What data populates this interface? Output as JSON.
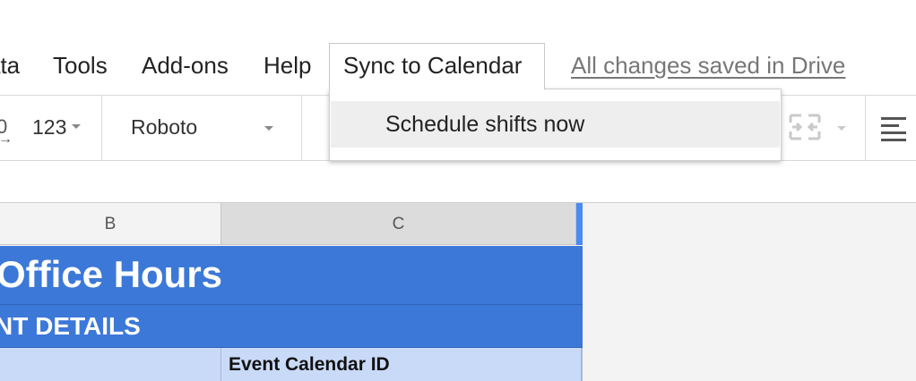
{
  "menubar": {
    "items": [
      {
        "label": "ata"
      },
      {
        "label": "Tools"
      },
      {
        "label": "Add-ons"
      },
      {
        "label": "Help"
      },
      {
        "label": "Sync to Calendar"
      }
    ],
    "save_status": "All changes saved in Drive"
  },
  "dropdown": {
    "items": [
      {
        "label": "Schedule shifts now"
      }
    ]
  },
  "toolbar": {
    "decimal_label": "0",
    "decimal_arrow": "→",
    "number_format_label": "123",
    "font_label": "Roboto",
    "merge_icon": "merge-cells-icon",
    "align_icon": "align-left-icon"
  },
  "sheet": {
    "column_headers": [
      "B",
      "C"
    ],
    "title": "Office Hours",
    "section": "NT DETAILS",
    "field_label": "Event Calendar ID"
  },
  "colors": {
    "header_blue": "#3c78d8",
    "light_blue_row": "#c9daf8",
    "selected_column_edge": "#4a8af4"
  }
}
